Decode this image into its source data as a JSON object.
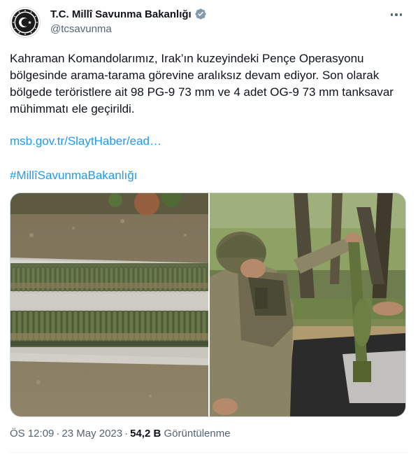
{
  "author": {
    "display_name": "T.C. Millî Savunma Bakanlığı",
    "handle": "@tcsavunma",
    "verified": true,
    "avatar_icon": "ministry-seal-icon"
  },
  "tweet": {
    "text_lines": [
      "Kahraman Komandolarımız, Irak’ın kuzeyindeki Pençe Operasyonu",
      "bölgesinde arama-tarama görevine aralıksız devam ediyor. Son olarak",
      "bölgede teröristlere ait 98 PG-9 73 mm ve 4 adet OG-9 73 mm tanksavar",
      "mühimmatı ele geçirildi."
    ],
    "link": "msb.gov.tr/SlaytHaber/ead…",
    "hashtag": "#MillîSavunmaBakanlığı"
  },
  "meta": {
    "time": "ÖS 12:09",
    "separator": "·",
    "date": "23 May 2023",
    "views_count": "54,2 B",
    "views_label": "Görüntülenme"
  },
  "colors": {
    "link": "#1d9bf0",
    "verified_badge": "#829aab",
    "text_primary": "#0f1419",
    "text_secondary": "#536471"
  }
}
